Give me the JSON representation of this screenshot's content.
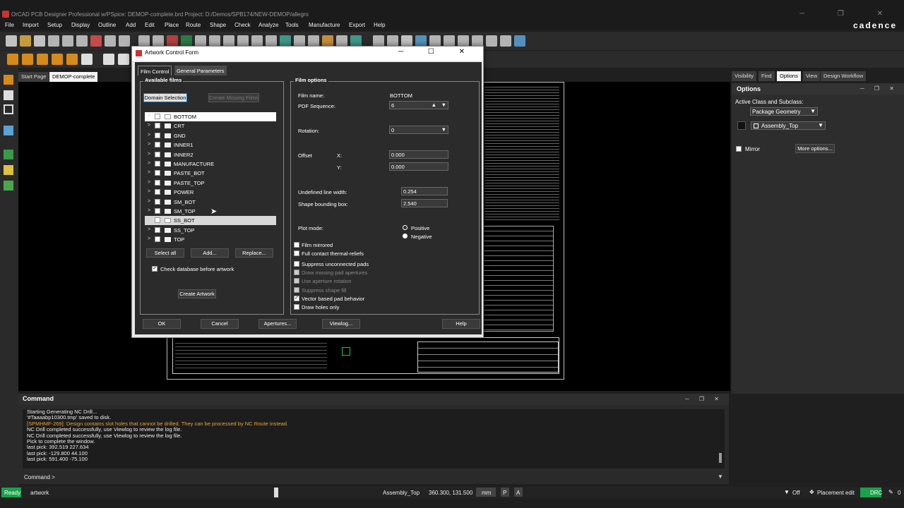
{
  "window": {
    "title": "OrCAD PCB Designer Professional w/PSpice: DEMOP-complete.brd  Project: D:/Demos/SPB174/NEW-DEMOP/allegro",
    "brand": "cadence"
  },
  "menu": [
    "File",
    "Import",
    "Setup",
    "Display",
    "Outline",
    "Add",
    "Edit",
    "Place",
    "Route",
    "Shape",
    "Check",
    "Analyze",
    "Tools",
    "Manufacture",
    "Export",
    "Help"
  ],
  "doc_tabs": {
    "start": "Start Page",
    "active": "DEMOP-complete"
  },
  "right_tabs": [
    "Visibility",
    "Find",
    "Options",
    "View",
    "Design Workflow"
  ],
  "options_panel": {
    "title": "Options",
    "class_label": "Active Class and Subclass:",
    "class_value": "Package Geometry",
    "subclass_value": "Assembly_Top",
    "mirror_label": "Mirror",
    "more_options": "More options..."
  },
  "command": {
    "title": "Command",
    "lines": [
      "Starting Generating NC Drill...",
      "'#Taaaabp10300.tmp' saved to disk.",
      "[SPMHMF-269]: Design contains slot holes that cannot be drilled. They can be processed by NC Route instead.",
      "NC Drill completed successfully, use Viewlog to review the log file.",
      "NC Drill completed successfully, use Viewlog to review the log file.",
      "Pick to complete the window.",
      "last pick:  392.519 227.634",
      "last pick:  -129.800 44.100",
      "last pick:  591.400 -75.100"
    ],
    "warning_color": "#e6a23c",
    "prompt": "Command >"
  },
  "status": {
    "ready": "Ready",
    "command": "artwork",
    "subclass": "Assembly_Top",
    "coords": "360.300, 131.500",
    "units": "mm",
    "p": "P",
    "a": "A",
    "filter": "Off",
    "placement": "Placement edit",
    "drc": "DRC",
    "count": "0"
  },
  "dialog": {
    "title": "Artwork Control Form",
    "tab_film": "Film Control",
    "tab_general": "General Parameters",
    "available_films": "Available films",
    "domain_selection": "Domain Selection",
    "create_missing": "Create Missing Films",
    "films": [
      "BOTTOM",
      "CRT",
      "GND",
      "INNER1",
      "INNER2",
      "MANUFACTURE",
      "PASTE_BOT",
      "PASTE_TOP",
      "POWER",
      "SM_BOT",
      "SM_TOP",
      "SS_BOT",
      "SS_TOP",
      "TOP"
    ],
    "select_all": "Select all",
    "add": "Add...",
    "replace": "Replace...",
    "check_db": "Check database before artwork",
    "create_artwork": "Create Artwork",
    "film_options": "Film options",
    "film_name_label": "Film name:",
    "film_name": "BOTTOM",
    "pdf_seq_label": "PDF Sequence:",
    "pdf_seq": "6",
    "rotation_label": "Rotation:",
    "rotation": "0",
    "offset_label": "Offset",
    "x_label": "X:",
    "x_val": "0.000",
    "y_label": "Y:",
    "y_val": "0.000",
    "undef_label": "Undefined line width:",
    "undef_val": "0.254",
    "shape_label": "Shape bounding box:",
    "shape_val": "2.540",
    "plot_mode_label": "Plot mode:",
    "positive": "Positive",
    "negative": "Negative",
    "checks": [
      {
        "label": "Film mirrored",
        "checked": false,
        "disabled": false
      },
      {
        "label": "Full contact thermal-reliefs",
        "checked": false,
        "disabled": false
      },
      {
        "label": "Suppress unconnected pads",
        "checked": false,
        "disabled": false
      },
      {
        "label": "Draw missing pad apertures",
        "checked": false,
        "disabled": true
      },
      {
        "label": "Use aperture rotation",
        "checked": false,
        "disabled": true
      },
      {
        "label": "Suppress shape fill",
        "checked": false,
        "disabled": true
      },
      {
        "label": "Vector based pad behavior",
        "checked": true,
        "disabled": false
      },
      {
        "label": "Draw holes only",
        "checked": false,
        "disabled": false
      }
    ],
    "ok": "OK",
    "cancel": "Cancel",
    "apertures": "Apertures...",
    "viewlog": "Viewlog...",
    "help": "Help"
  }
}
